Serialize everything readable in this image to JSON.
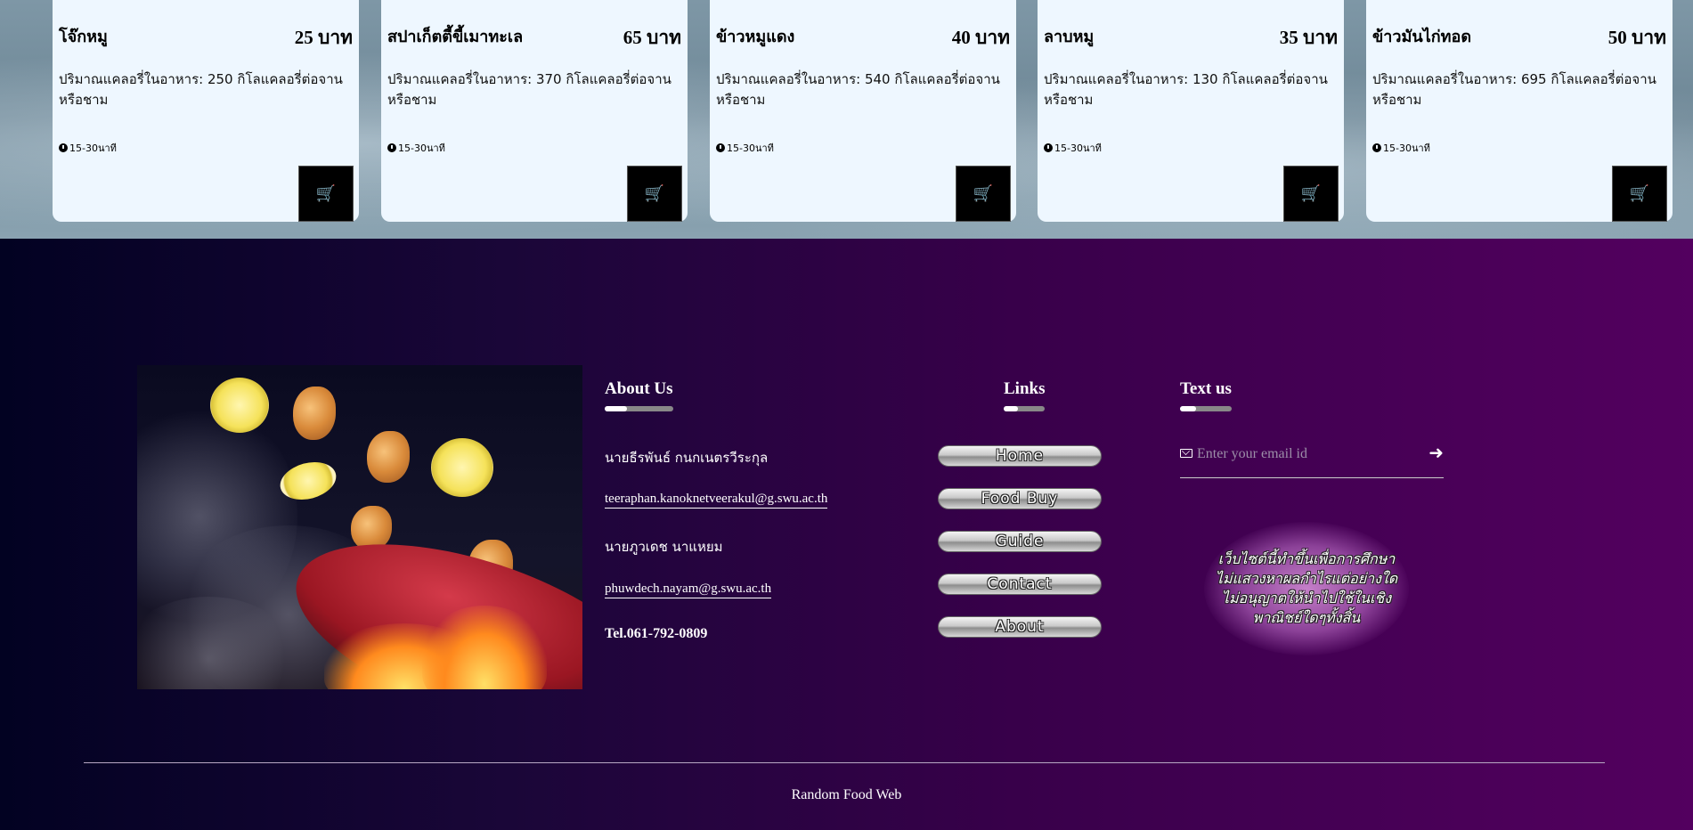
{
  "menu": {
    "items": [
      {
        "name": "โจ๊กหมู",
        "price": "25 บาท",
        "desc": "ปริมาณแคลอรี่ในอาหาร: 250 กิโลแคลอรี่ต่อจานหรือชาม",
        "time": "15-30นาที"
      },
      {
        "name": "สปาเก็ตตี้ขี้เมาทะเล",
        "price": "65 บาท",
        "desc": "ปริมาณแคลอรี่ในอาหาร: 370 กิโลแคลอรี่ต่อจานหรือชาม",
        "time": "15-30นาที"
      },
      {
        "name": "ข้าวหมูแดง",
        "price": "40 บาท",
        "desc": "ปริมาณแคลอรี่ในอาหาร: 540 กิโลแคลอรี่ต่อจานหรือชาม",
        "time": "15-30นาที"
      },
      {
        "name": "ลาบหมู",
        "price": "35 บาท",
        "desc": "ปริมาณแคลอรี่ในอาหาร: 130 กิโลแคลอรี่ต่อจานหรือชาม",
        "time": "15-30นาที"
      },
      {
        "name": "ข้าวมันไก่ทอด",
        "price": "50 บาท",
        "desc": "ปริมาณแคลอรี่ในอาหาร: 695 กิโลแคลอรี่ต่อจานหรือชาม",
        "time": "15-30นาที"
      }
    ],
    "cart_icon": "cart-plus-icon",
    "clock_icon": "clock-icon"
  },
  "footer": {
    "about": {
      "title": "About Us",
      "member1_name": "นายธีรพันธ์ กนกเนตรวีระกุล",
      "member1_email": "teeraphan.kanoknetveerakul@g.swu.ac.th",
      "member2_name": "นายภูวเดช นาแหยม",
      "member2_email": "phuwdech.nayam@g.swu.ac.th",
      "tel": "Tel.061-792-0809"
    },
    "links": {
      "title": "Links",
      "items": [
        "Home",
        "Food Buy",
        "Guide",
        "Contact",
        "About"
      ]
    },
    "text_us": {
      "title": "Text us",
      "email_placeholder": "Enter your email id",
      "arrow": "➜",
      "notice": "เว็บไซต์นี้ทำขึ้นเพื่อการศึกษา ไม่แสวงหาผลกำไรแต่อย่างใด ไม่อนุญาตให้นำไปใช้ในเชิงพาณิชย์ใดๆทั้งสิ้น"
    },
    "copyright": "Random Food Web"
  },
  "colors": {
    "card_bg": "#eef7ff",
    "footer_start": "#020222",
    "footer_end": "#53005f"
  }
}
